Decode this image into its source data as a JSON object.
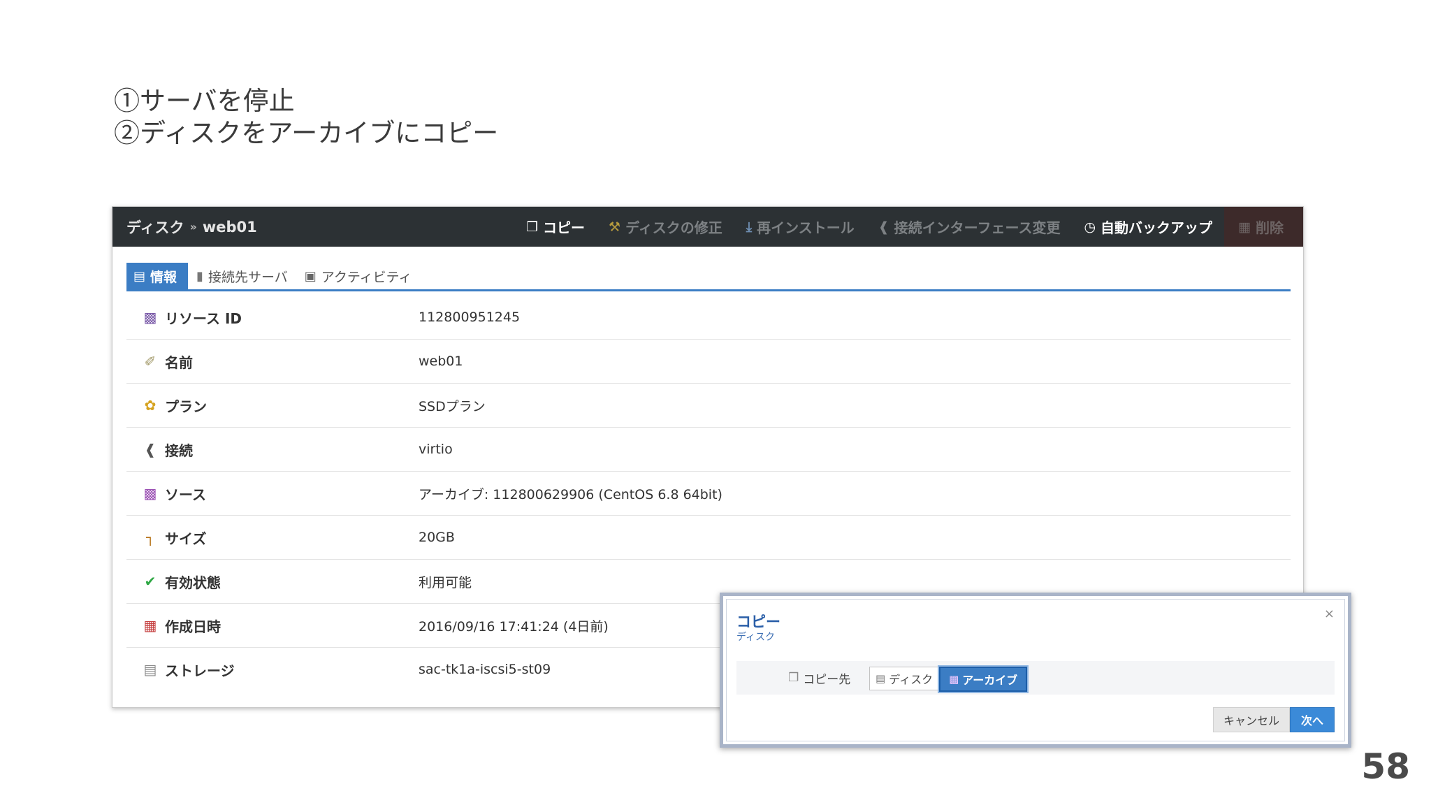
{
  "slide": {
    "steps": [
      "①サーバを停止",
      "②ディスクをアーカイブにコピー"
    ],
    "page_number": "58"
  },
  "topbar": {
    "crumb_section": "ディスク",
    "crumb_separator": "»",
    "crumb_item": "web01",
    "actions": [
      {
        "label": "コピー",
        "icon": "copy-icon",
        "state": "enabled"
      },
      {
        "label": "ディスクの修正",
        "icon": "wrench-icon",
        "state": "disabled"
      },
      {
        "label": "再インストール",
        "icon": "install-icon",
        "state": "disabled"
      },
      {
        "label": "接続インターフェース変更",
        "icon": "connection-icon",
        "state": "disabled"
      },
      {
        "label": "自動バックアップ",
        "icon": "clock-icon",
        "state": "enabled"
      },
      {
        "label": "削除",
        "icon": "trash-icon",
        "state": "disabled"
      }
    ]
  },
  "tabs": [
    {
      "label": "情報",
      "icon": "info-icon",
      "active": true
    },
    {
      "label": "接続先サーバ",
      "icon": "server-icon",
      "active": false
    },
    {
      "label": "アクティビティ",
      "icon": "monitor-icon",
      "active": false
    }
  ],
  "details": [
    {
      "label": "リソース ID",
      "value": "112800951245",
      "icon": "id-card-icon"
    },
    {
      "label": "名前",
      "value": "web01",
      "icon": "tag-icon"
    },
    {
      "label": "プラン",
      "value": "SSDプラン",
      "icon": "medal-icon"
    },
    {
      "label": "接続",
      "value": "virtio",
      "icon": "connection-icon"
    },
    {
      "label": "ソース",
      "value": "アーカイブ: 112800629906 (CentOS 6.8 64bit)",
      "icon": "floppy-icon"
    },
    {
      "label": "サイズ",
      "value": "20GB",
      "icon": "ruler-icon"
    },
    {
      "label": "有効状態",
      "value": "利用可能",
      "icon": "check-circle-icon"
    },
    {
      "label": "作成日時",
      "value": "2016/09/16 17:41:24 (4日前)",
      "icon": "calendar-icon"
    },
    {
      "label": "ストレージ",
      "value": "sac-tk1a-iscsi5-st09",
      "icon": "storage-icon"
    }
  ],
  "dialog": {
    "title": "コピー",
    "subtitle": "ディスク",
    "close": "×",
    "target_label": "コピー先",
    "options": [
      {
        "label": "ディスク",
        "selected": false
      },
      {
        "label": "アーカイブ",
        "selected": true
      }
    ],
    "cancel": "キャンセル",
    "next": "次へ"
  },
  "colors": {
    "topbar": "#2c3134",
    "accent": "#3b7dc4",
    "next_button": "#3b8ad8"
  }
}
